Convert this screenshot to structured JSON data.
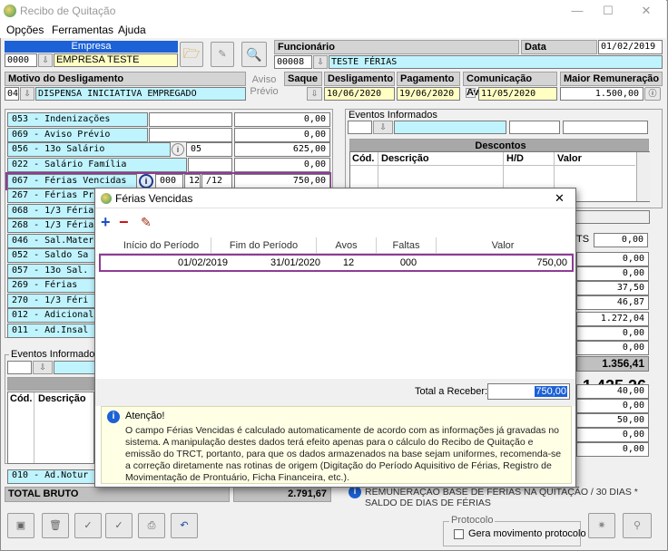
{
  "window": {
    "title": "Recibo de Quitação",
    "min": "—",
    "max": "☐",
    "close": "✕"
  },
  "menu": [
    "Opções",
    "Ferramentas",
    "Ajuda"
  ],
  "empresa": {
    "label": "Empresa",
    "code": "0000",
    "name": "EMPRESA TESTE"
  },
  "funcionario": {
    "label": "Funcionário",
    "code": "00008",
    "name": "TESTE FÉRIAS"
  },
  "admissao": {
    "label": "Data Admissão:",
    "value": "01/02/2019"
  },
  "motivo": {
    "label": "Motivo do Desligamento",
    "code": "04",
    "value": "DISPENSA INICIATIVA EMPREGADO"
  },
  "aviso_previo": "Aviso Prévio",
  "saque": "Saque",
  "desligamento": {
    "label": "Desligamento",
    "value": "10/06/2020"
  },
  "pagamento": {
    "label": "Pagamento",
    "value": "19/06/2020"
  },
  "comunicacao": {
    "label": "Comunicação Aviso",
    "value": "11/05/2020"
  },
  "maior_remuneracao": {
    "label": "Maior Remuneração",
    "value": "1.500,00"
  },
  "verbas": [
    {
      "label": "053 - Indenizações",
      "ref": "",
      "val": "0,00"
    },
    {
      "label": "069 - Aviso Prévio",
      "ref": "",
      "val": "0,00"
    },
    {
      "label": "056 - 13o Salário",
      "ref": "05",
      "val": "625,00"
    },
    {
      "label": "022 - Salário Família",
      "ref": "",
      "val": "0,00"
    },
    {
      "label": "067 - Férias Vencidas",
      "ref": "000",
      "ref2": "12",
      "ref3": "/12",
      "val": "750,00"
    },
    {
      "label": "267 - Férias Pr"
    },
    {
      "label": "068 - 1/3 Féria"
    },
    {
      "label": "268 - 1/3 Féria"
    },
    {
      "label": "046 - Sal.Mater"
    },
    {
      "label": "052 - Saldo Sa"
    },
    {
      "label": "057 - 13o Sal."
    },
    {
      "label": "269 - Férias"
    },
    {
      "label": "270 - 1/3 Féri"
    },
    {
      "label": "012 - Adicional"
    },
    {
      "label": "011 - Ad.Insal"
    }
  ],
  "eventos_informados": "Eventos Informados",
  "descontos": {
    "title": "Descontos",
    "cols": [
      "Cód.",
      "Descrição",
      "H/D",
      "Valor"
    ]
  },
  "left_events_cols": [
    "Cód.",
    "Descrição"
  ],
  "right_vals": [
    "0,00",
    "0,00",
    "37,50",
    "46,87",
    "1.272,04",
    "0,00",
    "0,00",
    "1.356,41",
    "1.435,26",
    "40,00",
    "0,00",
    "50,00",
    "0,00",
    "0,00"
  ],
  "ts_label": "TS",
  "ts_value": "0,00",
  "ad_noturno": "010 - Ad.Notur",
  "total_bruto": {
    "label": "TOTAL BRUTO",
    "value": "2.791,67"
  },
  "rem_note": "REMUNERAÇÃO BASE DE FÉRIAS NA QUITAÇÃO / 30 DIAS * SALDO DE DIAS DE FÉRIAS",
  "protocolo": {
    "title": "Protocolo",
    "check": "Gera movimento protocolo"
  },
  "dialog": {
    "title": "Férias Vencidas",
    "close": "✕",
    "cols": [
      "Início do Período",
      "Fim do Período",
      "Avos",
      "Faltas",
      "Valor"
    ],
    "row": {
      "inicio": "01/02/2019",
      "fim": "31/01/2020",
      "avos": "12",
      "faltas": "000",
      "valor": "750,00"
    },
    "total_label": "Total a Receber:",
    "total_value": "750,00",
    "note_title": "Atenção!",
    "note_text": "O campo Férias Vencidas é calculado automaticamente de acordo com as informações já gravadas no sistema. A manipulação destes dados terá efeito apenas para o cálculo do Recibo de Quitação e emissão do TRCT, portanto, para que os dados armazenados na base sejam uniformes, recomenda-se a correção diretamente nas rotinas de origem (Digitação do Período Aquisitivo de Férias, Registro de Movimentação de Prontuário, Ficha Financeira, etc.)."
  }
}
